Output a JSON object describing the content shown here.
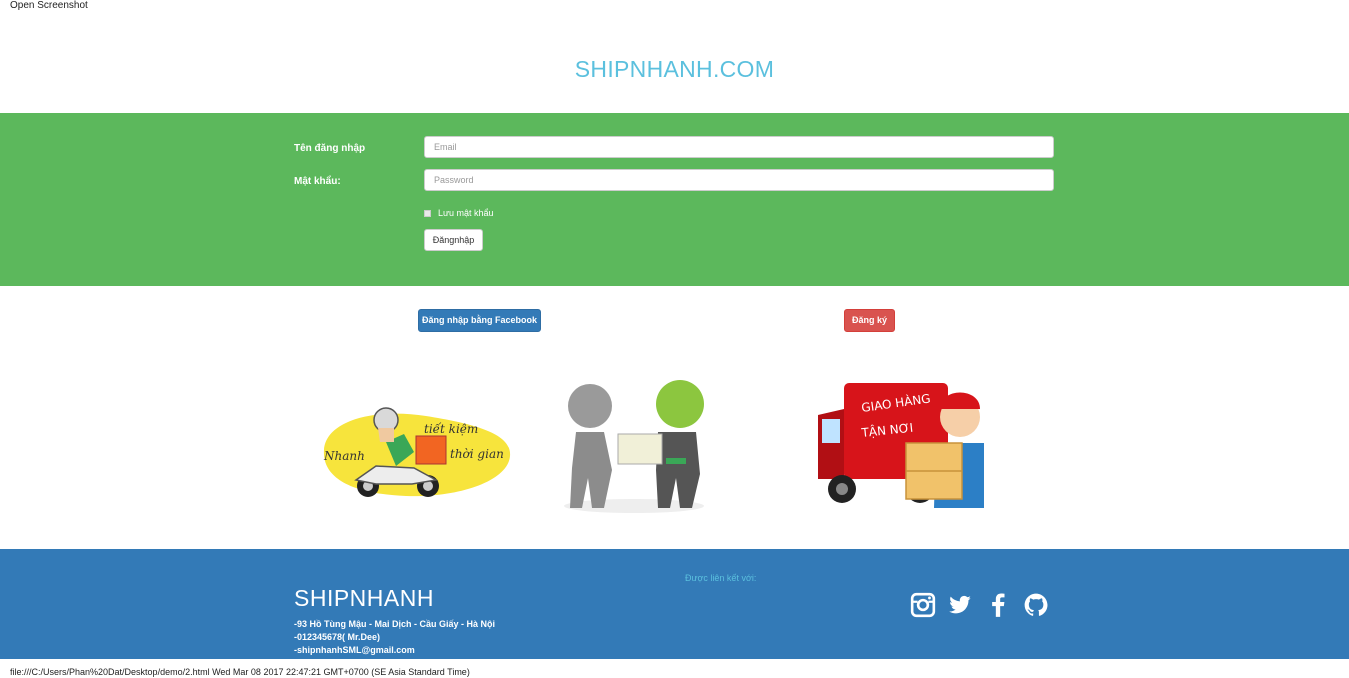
{
  "caption": "Open Screenshot",
  "site_title": "SHIPNHANH.COM",
  "login": {
    "username_label": "Tên đăng nhập",
    "password_label": "Mật khẩu:",
    "email_placeholder": "Email",
    "password_placeholder": "Password",
    "remember_label": "Lưu mật khẩu",
    "submit_label": "Đăngnhập"
  },
  "actions": {
    "facebook_label": "Đăng nhập bằng Facebook",
    "register_label": "Đăng ký"
  },
  "banner_texts": {
    "scooter_word1": "Nhanh",
    "scooter_word2": "tiết kiệm",
    "scooter_word3": "thời gian",
    "truck_word1": "GIAO HÀNG",
    "truck_word2": "TẬN NƠI"
  },
  "footer": {
    "brand": "SHIPNHANH",
    "address": "-93 Hồ Tùng Mậu - Mai Dịch - Cầu Giấy - Hà Nội",
    "phone": "-012345678( Mr.Dee)",
    "email": "-shipnhanhSML@gmail.com",
    "connect_label": "Được liên kết với:",
    "social_icons": [
      "instagram-icon",
      "twitter-icon",
      "facebook-icon",
      "github-icon"
    ]
  },
  "status_bar": "file:///C:/Users/Phan%20Dat/Desktop/demo/2.html Wed Mar 08 2017 22:47:21 GMT+0700 (SE Asia Standard Time)",
  "colors": {
    "title_blue": "#5bc0de",
    "login_green": "#5cb85c",
    "footer_blue": "#337ab7",
    "register_red": "#d9534f"
  }
}
